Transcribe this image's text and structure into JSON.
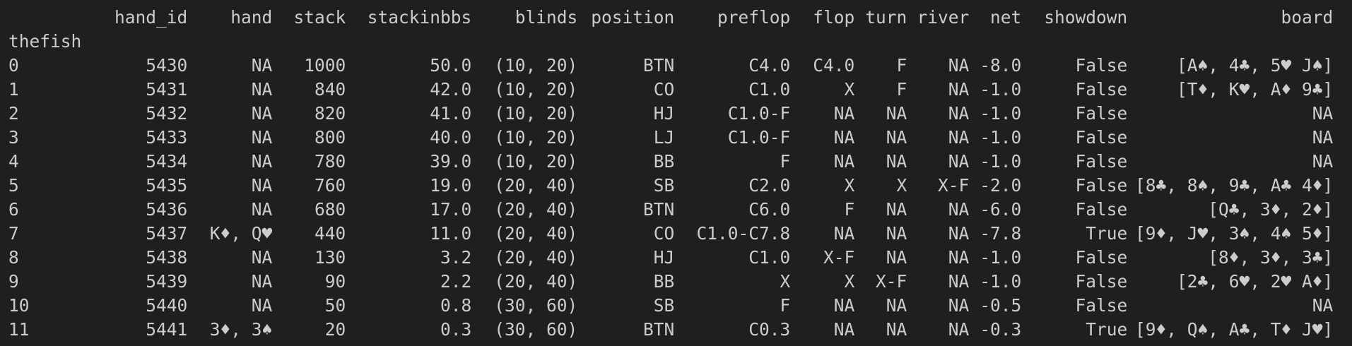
{
  "table": {
    "index_name": "thefish",
    "columns": [
      "hand_id",
      "hand",
      "stack",
      "stackinbbs",
      "blinds",
      "position",
      "preflop",
      "flop",
      "turn",
      "river",
      "net",
      "showdown",
      "board"
    ],
    "rows": [
      [
        "0",
        "5430",
        "NA",
        "1000",
        "50.0",
        "(10, 20)",
        "BTN",
        "C4.0",
        "C4.0",
        "F",
        "NA",
        "-8.0",
        "False",
        "[A♠, 4♣, 5♥ J♠]"
      ],
      [
        "1",
        "5431",
        "NA",
        "840",
        "42.0",
        "(10, 20)",
        "CO",
        "C1.0",
        "X",
        "F",
        "NA",
        "-1.0",
        "False",
        "[T♦, K♥, A♦ 9♣]"
      ],
      [
        "2",
        "5432",
        "NA",
        "820",
        "41.0",
        "(10, 20)",
        "HJ",
        "C1.0-F",
        "NA",
        "NA",
        "NA",
        "-1.0",
        "False",
        "NA"
      ],
      [
        "3",
        "5433",
        "NA",
        "800",
        "40.0",
        "(10, 20)",
        "LJ",
        "C1.0-F",
        "NA",
        "NA",
        "NA",
        "-1.0",
        "False",
        "NA"
      ],
      [
        "4",
        "5434",
        "NA",
        "780",
        "39.0",
        "(10, 20)",
        "BB",
        "F",
        "NA",
        "NA",
        "NA",
        "-1.0",
        "False",
        "NA"
      ],
      [
        "5",
        "5435",
        "NA",
        "760",
        "19.0",
        "(20, 40)",
        "SB",
        "C2.0",
        "X",
        "X",
        "X-F",
        "-2.0",
        "False",
        "[8♣, 8♠, 9♣, A♣ 4♦]"
      ],
      [
        "6",
        "5436",
        "NA",
        "680",
        "17.0",
        "(20, 40)",
        "BTN",
        "C6.0",
        "F",
        "NA",
        "NA",
        "-6.0",
        "False",
        "[Q♣, 3♦, 2♦]"
      ],
      [
        "7",
        "5437",
        "K♦, Q♥",
        "440",
        "11.0",
        "(20, 40)",
        "CO",
        "C1.0-C7.8",
        "NA",
        "NA",
        "NA",
        "-7.8",
        "True",
        "[9♦, J♥, 3♠, 4♠ 5♦]"
      ],
      [
        "8",
        "5438",
        "NA",
        "130",
        "3.2",
        "(20, 40)",
        "HJ",
        "C1.0",
        "X-F",
        "NA",
        "NA",
        "-1.0",
        "False",
        "[8♦, 3♦, 3♣]"
      ],
      [
        "9",
        "5439",
        "NA",
        "90",
        "2.2",
        "(20, 40)",
        "BB",
        "X",
        "X",
        "X-F",
        "NA",
        "-1.0",
        "False",
        "[2♣, 6♥, 2♥ A♦]"
      ],
      [
        "10",
        "5440",
        "NA",
        "50",
        "0.8",
        "(30, 60)",
        "SB",
        "F",
        "NA",
        "NA",
        "NA",
        "-0.5",
        "False",
        "NA"
      ],
      [
        "11",
        "5441",
        "3♦, 3♠",
        "20",
        "0.3",
        "(30, 60)",
        "BTN",
        "C0.3",
        "NA",
        "NA",
        "NA",
        "-0.3",
        "True",
        "[9♦, Q♠, A♣, T♦ J♥]"
      ]
    ]
  }
}
